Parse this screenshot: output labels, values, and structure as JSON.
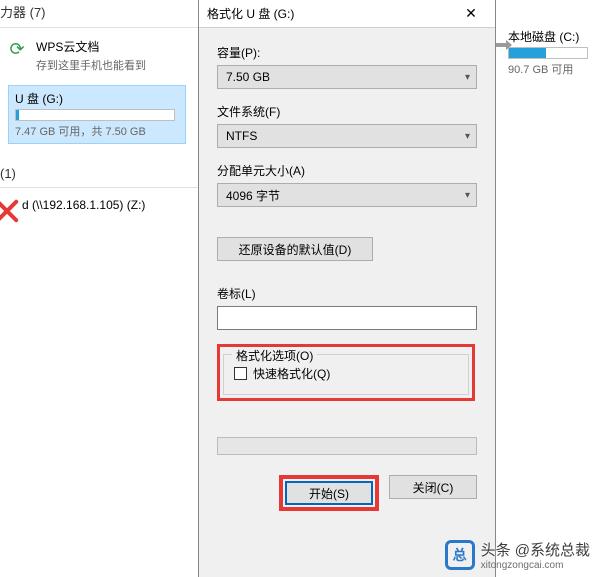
{
  "left": {
    "header": "力器 (7)",
    "wps": {
      "name": "WPS云文档",
      "sub": "存到这里手机也能看到"
    },
    "udrive": {
      "name": "U 盘 (G:)",
      "cap_text": "7.47 GB 可用，共 7.50 GB",
      "fill_pct": 2
    },
    "net_header": "(1)",
    "netdrive": {
      "name": "d (\\\\192.168.1.105) (Z:)"
    }
  },
  "right": {
    "local": {
      "name": "本地磁盘 (C:)",
      "cap_text": "90.7 GB 可用",
      "fill_pct": 48
    }
  },
  "dialog": {
    "title": "格式化 U 盘 (G:)",
    "capacity_label": "容量(P):",
    "capacity_value": "7.50 GB",
    "fs_label": "文件系统(F)",
    "fs_value": "NTFS",
    "alloc_label": "分配单元大小(A)",
    "alloc_value": "4096 字节",
    "restore_btn": "还原设备的默认值(D)",
    "volume_label": "卷标(L)",
    "volume_value": "",
    "options_label": "格式化选项(O)",
    "quick_format": "快速格式化(Q)",
    "start_btn": "开始(S)",
    "close_btn": "关闭(C)"
  },
  "watermark": {
    "brand": "头条 @系统总裁",
    "sub": "xitongzongcai.com"
  },
  "icons": {
    "close": "✕",
    "chevron": "▾",
    "sync": "⟳",
    "drive": "💾",
    "net": "🖧",
    "hdd": "🖴"
  }
}
